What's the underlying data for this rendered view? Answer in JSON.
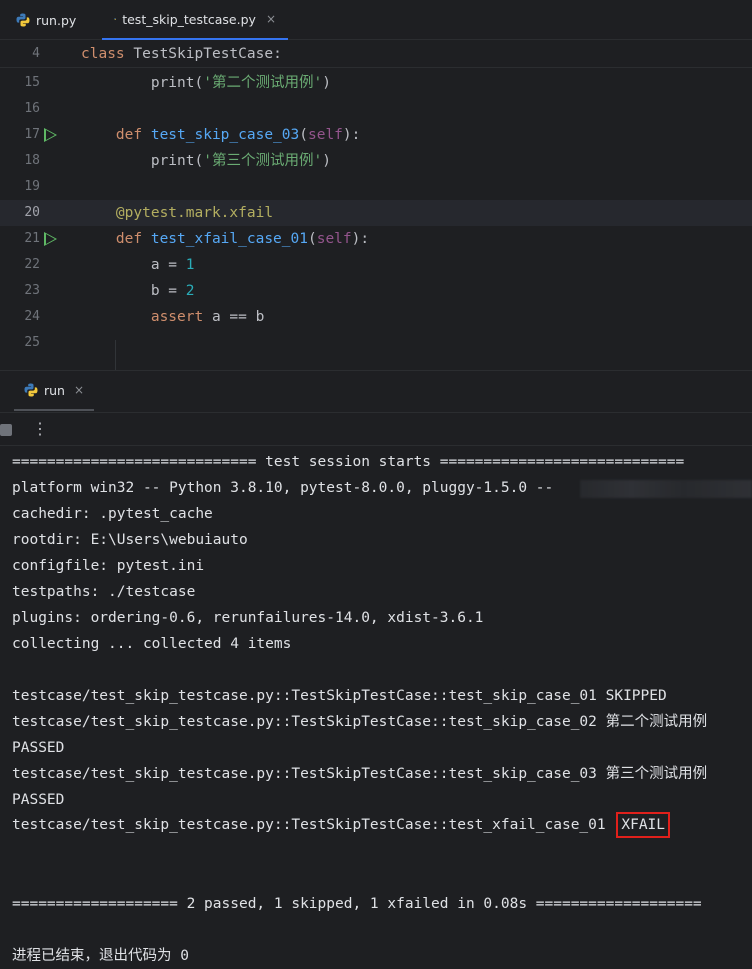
{
  "tabs": [
    {
      "label": "run.py",
      "active": false
    },
    {
      "label": "test_skip_testcase.py",
      "active": true,
      "close": "×"
    }
  ],
  "sticky_line": {
    "number": "4",
    "keyword": "class",
    "name": "TestSkipTestCase:"
  },
  "editor_lines": [
    {
      "number": "15",
      "indent": "        ",
      "tokens": [
        {
          "t": "print(",
          "c": "plain"
        },
        {
          "t": "'第二个测试用例'",
          "c": "str"
        },
        {
          "t": ")",
          "c": "plain"
        }
      ]
    },
    {
      "number": "16",
      "indent": "",
      "tokens": []
    },
    {
      "number": "17",
      "run": true,
      "indent": "    ",
      "tokens": [
        {
          "t": "def ",
          "c": "kw"
        },
        {
          "t": "test_skip_case_03",
          "c": "fn"
        },
        {
          "t": "(",
          "c": "plain"
        },
        {
          "t": "self",
          "c": "slf"
        },
        {
          "t": "):",
          "c": "plain"
        }
      ]
    },
    {
      "number": "18",
      "indent": "        ",
      "tokens": [
        {
          "t": "print(",
          "c": "plain"
        },
        {
          "t": "'第三个测试用例'",
          "c": "str"
        },
        {
          "t": ")",
          "c": "plain"
        }
      ]
    },
    {
      "number": "19",
      "indent": "",
      "tokens": []
    },
    {
      "number": "20",
      "current": true,
      "indent": "    ",
      "tokens": [
        {
          "t": "@pytest.mark.",
          "c": "deco"
        },
        {
          "t": "xfail",
          "c": "deco"
        }
      ]
    },
    {
      "number": "21",
      "run": true,
      "indent": "    ",
      "tokens": [
        {
          "t": "def ",
          "c": "kw"
        },
        {
          "t": "test_xfail_case_01",
          "c": "fn"
        },
        {
          "t": "(",
          "c": "plain"
        },
        {
          "t": "self",
          "c": "slf"
        },
        {
          "t": "):",
          "c": "plain"
        }
      ]
    },
    {
      "number": "22",
      "indent": "        ",
      "tokens": [
        {
          "t": "a = ",
          "c": "plain"
        },
        {
          "t": "1",
          "c": "num"
        }
      ]
    },
    {
      "number": "23",
      "indent": "        ",
      "tokens": [
        {
          "t": "b = ",
          "c": "plain"
        },
        {
          "t": "2",
          "c": "num"
        }
      ]
    },
    {
      "number": "24",
      "indent": "        ",
      "tokens": [
        {
          "t": "assert ",
          "c": "kw"
        },
        {
          "t": "a == b",
          "c": "plain"
        }
      ]
    },
    {
      "number": "25",
      "indent": "",
      "tokens": []
    }
  ],
  "run_panel": {
    "tab_label": "run",
    "close": "×",
    "more_icon": "⋮"
  },
  "console_lines": [
    "============================ test session starts ============================",
    "platform win32 -- Python 3.8.10, pytest-8.0.0, pluggy-1.5.0 --",
    "cachedir: .pytest_cache",
    "rootdir: E:\\Users\\webuiauto",
    "configfile: pytest.ini",
    "testpaths: ./testcase",
    "plugins: ordering-0.6, rerunfailures-14.0, xdist-3.6.1",
    "collecting ... collected 4 items",
    "",
    "testcase/test_skip_testcase.py::TestSkipTestCase::test_skip_case_01 SKIPPED",
    "testcase/test_skip_testcase.py::TestSkipTestCase::test_skip_case_02 第二个测试用例",
    "PASSED",
    "testcase/test_skip_testcase.py::TestSkipTestCase::test_skip_case_03 第三个测试用例",
    "PASSED",
    "",
    "",
    "=================== 2 passed, 1 skipped, 1 xfailed in 0.08s ===================",
    "",
    "进程已结束，退出代码为 0"
  ],
  "xfail_line": {
    "prefix": "testcase/test_skip_testcase.py::TestSkipTestCase::test_xfail_case_01 ",
    "status": "XFAIL"
  },
  "colors": {
    "highlight_box": "#e0201b",
    "run_arrow": "#5fb865",
    "active_tab_underline": "#3574f0"
  }
}
